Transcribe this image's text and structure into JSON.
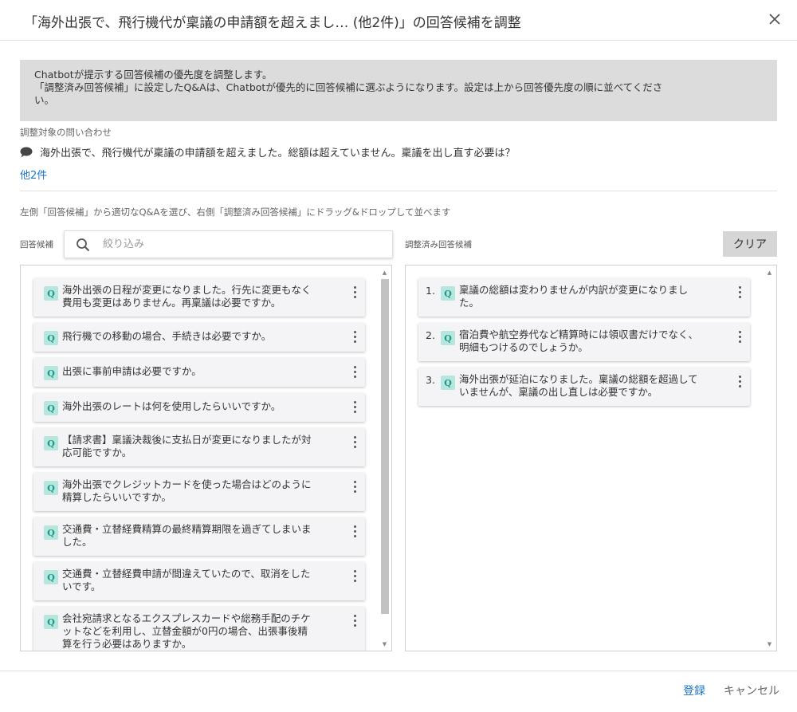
{
  "dialog": {
    "title": "「海外出張で、飛行機代が稟議の申請額を超えまし… (他2件)」の回答候補を調整",
    "close_icon": "close-icon"
  },
  "notice": {
    "line1": "Chatbotが提示する回答候補の優先度を調整します。",
    "line2": "「調整済み回答候補」に設定したQ&Aは、Chatbotが優先的に回答候補に選ぶようになります。設定は上から回答優先度の順に並べてくださ",
    "line3": "い。"
  },
  "inquiry": {
    "label": "調整対象の問い合わせ",
    "icon": "chat-bubble-icon",
    "text": "海外出張で、飛行機代が稟議の申請額を超えました。総額は超えていません。稟議を出し直す必要は？",
    "others_link": "他2件"
  },
  "instruction": "左側「回答候補」から適切なQ&Aを選び、右側「調整済み回答候補」にドラッグ&ドロップして並べます",
  "left_panel": {
    "label": "回答候補",
    "search_placeholder": "絞り込み",
    "search_value": "",
    "items": [
      {
        "badge": "Q",
        "lines": [
          "海外出張の日程が変更になりました。行先に変更もなく",
          "費用も変更はありません。再稟議は必要ですか。"
        ]
      },
      {
        "badge": "Q",
        "lines": [
          "飛行機での移動の場合、手続きは必要ですか。"
        ]
      },
      {
        "badge": "Q",
        "lines": [
          "出張に事前申請は必要ですか。"
        ]
      },
      {
        "badge": "Q",
        "lines": [
          "海外出張のレートは何を使用したらいいですか。"
        ]
      },
      {
        "badge": "Q",
        "lines": [
          "【請求書】稟議決裁後に支払日が変更になりましたが対",
          "応可能ですか。"
        ]
      },
      {
        "badge": "Q",
        "lines": [
          "海外出張でクレジットカードを使った場合はどのように",
          "精算したらいいですか。"
        ]
      },
      {
        "badge": "Q",
        "lines": [
          "交通費・立替経費精算の最終精算期限を過ぎてしまいま",
          "した。"
        ]
      },
      {
        "badge": "Q",
        "lines": [
          "交通費・立替経費申請が間違えていたので、取消をした",
          "いです。"
        ]
      },
      {
        "badge": "Q",
        "lines": [
          "会社宛請求となるエクスプレスカードや総務手配のチケ",
          "ットなどを利用し、立替金額が0円の場合、出張事後精",
          "算を行う必要はありますか。"
        ]
      }
    ]
  },
  "right_panel": {
    "label": "調整済み回答候補",
    "clear_label": "クリア",
    "items": [
      {
        "num": "1.",
        "badge": "Q",
        "lines": [
          "稟議の総額は変わりませんが内訳が変更になりまし",
          "た。"
        ]
      },
      {
        "num": "2.",
        "badge": "Q",
        "lines": [
          "宿泊費や航空券代など精算時には領収書だけでなく、",
          "明細もつけるのでしょうか。"
        ]
      },
      {
        "num": "3.",
        "badge": "Q",
        "lines": [
          "海外出張が延泊になりました。稟議の総額を超過して",
          "いませんが、稟議の出し直しは必要ですか。"
        ]
      }
    ]
  },
  "footer": {
    "register_label": "登録",
    "cancel_label": "キャンセル"
  }
}
